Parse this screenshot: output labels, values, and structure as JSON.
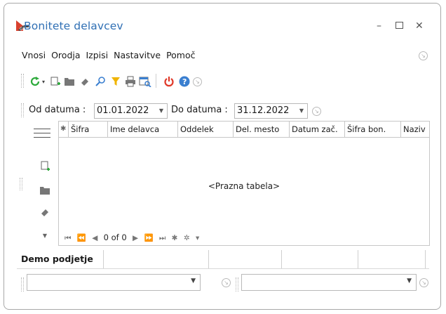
{
  "window": {
    "title": "Bonitete delavcev",
    "minimize_glyph": "–",
    "maximize_glyph": "▫",
    "close_glyph": "✕"
  },
  "menu": {
    "items": [
      "Vnosi",
      "Orodja",
      "Izpisi",
      "Nastavitve",
      "Pomoč"
    ]
  },
  "toolbar": {
    "icons": [
      "refresh-icon",
      "new-document-icon",
      "open-folder-icon",
      "eraser-icon",
      "search-icon",
      "filter-icon",
      "print-icon",
      "report-search-icon",
      "power-icon",
      "help-icon",
      "expand-icon"
    ]
  },
  "filter": {
    "from_label": "Od datuma :",
    "from_value": "01.01.2022",
    "to_label": "Do datuma :",
    "to_value": "31.12.2022"
  },
  "grid": {
    "columns": [
      "Šifra",
      "Ime delavca",
      "Oddelek",
      "Del. mesto",
      "Datum zač.",
      "Šifra bon.",
      "Naziv"
    ],
    "empty_text": "<Prazna tabela>",
    "record_count": "0 of 0"
  },
  "bottom": {
    "tab_label": "Demo podjetje",
    "combo1_value": "",
    "combo2_value": ""
  },
  "colors": {
    "title": "#2f6fb4",
    "refresh": "#2eaa3c",
    "filter": "#f0b400",
    "power": "#e03a2a",
    "help": "#3a7fd0"
  }
}
